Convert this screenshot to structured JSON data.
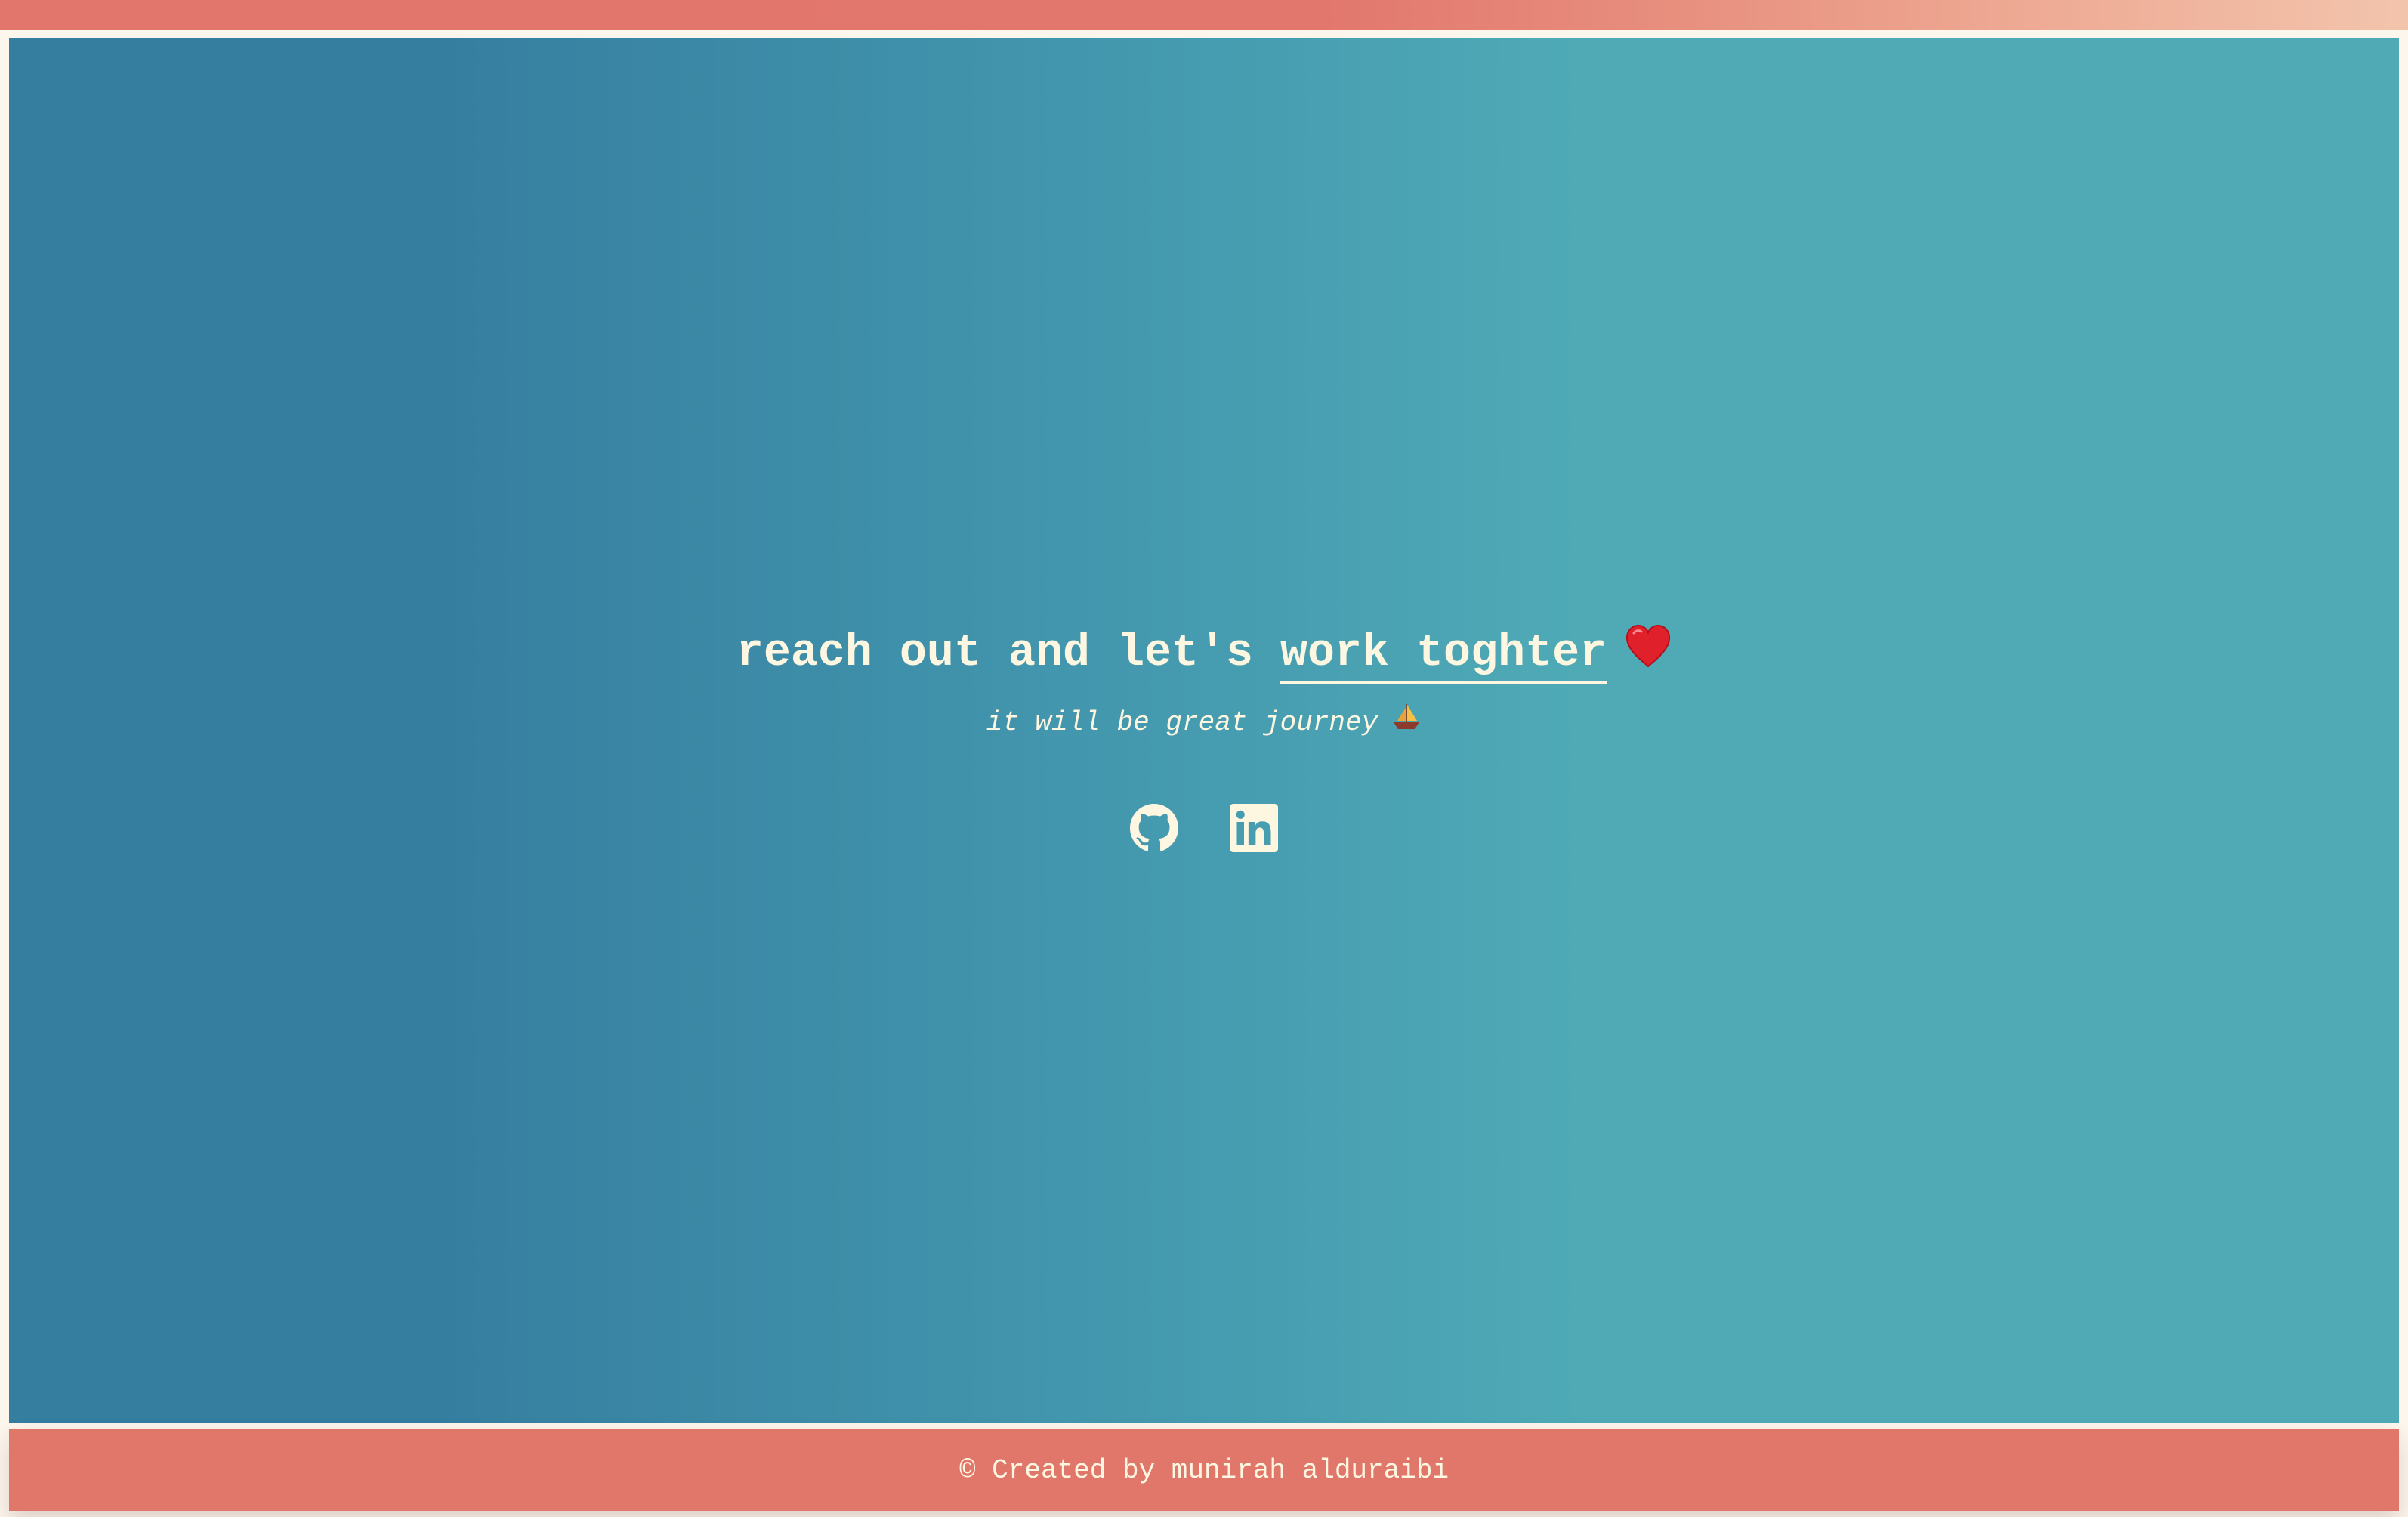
{
  "colors": {
    "accent": "#e1766b",
    "background_start": "#367ea0",
    "background_end": "#4faab6",
    "text": "#fdf6e0"
  },
  "hero": {
    "headline_prefix": "reach out and let's ",
    "headline_link": "work toghter",
    "headline_icon": "heart-icon",
    "subtitle": "it will be great journey",
    "subtitle_icon": "sailboat-icon"
  },
  "socials": [
    {
      "icon": "github-icon"
    },
    {
      "icon": "linkedin-icon"
    }
  ],
  "footer": {
    "text": "© Created by munirah alduraibi"
  }
}
